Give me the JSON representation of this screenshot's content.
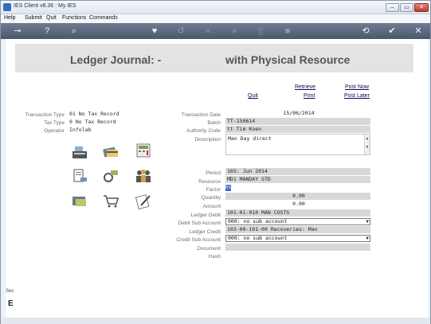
{
  "window": {
    "title": "IES Client v8.36 : My IES",
    "min_label": "–",
    "max_label": "▭",
    "close_label": "✕"
  },
  "menu": [
    "Help",
    "Submit",
    "Quit",
    "Functions",
    "Commands"
  ],
  "header": {
    "title_left": "Ledger Journal: -",
    "title_right": "with Physical Resource"
  },
  "actions": {
    "retrieve": "Retrieve",
    "post_now": "Post Now",
    "quit": "Quit",
    "print": "Print",
    "post_later": "Post Later"
  },
  "left_info": {
    "transaction_type_label": "Transaction Type",
    "transaction_type": "01 No Tax Record",
    "tax_type_label": "Tax Type",
    "tax_type": "0 No Tax Record",
    "operator_label": "Operator",
    "operator": "Infolab"
  },
  "form": {
    "transaction_date_label": "Transaction Date",
    "transaction_date": "15/06/2014",
    "batch_label": "Batch",
    "batch": "TT-150614",
    "authority_code_label": "Authority Code",
    "authority_code": "tt Tim Koen",
    "description_label": "Description",
    "description": "Man Day direct",
    "period_label": "Period",
    "period": "165: Jun 2014",
    "resource_label": "Resource",
    "resource": "MD1 MANDAY STD",
    "factor_label": "Factor",
    "factor": "01",
    "quantity_label": "Quantity",
    "quantity": "0.00",
    "amount_label": "Amount",
    "amount": "0.00",
    "ledger_debit_label": "Ledger Debit",
    "ledger_debit": "101-01-010 MAN COSTS",
    "debit_sub_account_label": "Debit Sub Account",
    "debit_sub_account": "000: no sub account",
    "ledger_credit_label": "Ledger Credit",
    "ledger_credit": "103-00-101-00 Recoveries: Man",
    "credit_sub_account_label": "Credit Sub Account",
    "credit_sub_account": "000: no sub account",
    "document_label": "Document",
    "document": "",
    "hash_label": "Hash",
    "hash": ""
  },
  "side": {
    "tab": "Ses",
    "letter": "E"
  }
}
